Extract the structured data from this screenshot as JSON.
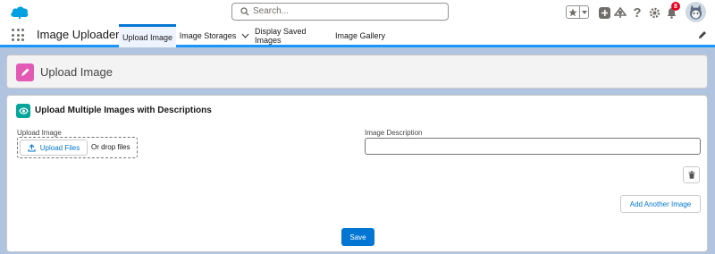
{
  "header": {
    "search_placeholder": "Search...",
    "notification_count": "8",
    "icons": [
      "salesforce-cloud-icon",
      "search-icon",
      "star-icon",
      "chevron-down-icon",
      "add-icon",
      "trailhead-icon",
      "help-icon",
      "gear-icon",
      "bell-icon",
      "avatar"
    ]
  },
  "nav": {
    "app_name": "Image Uploader",
    "tabs": [
      {
        "label": "Upload Image",
        "active": true
      },
      {
        "label": "Image Storages",
        "active": false
      },
      {
        "label": "Display Saved Images",
        "active": false
      },
      {
        "label": "Image Gallery",
        "active": false
      }
    ]
  },
  "page_header": {
    "title": "Upload Image"
  },
  "card": {
    "title": "Upload Multiple Images with Descriptions",
    "upload_label": "Upload Image",
    "upload_button": "Upload Files",
    "drop_text": "Or drop files",
    "description_label": "Image Description",
    "description_value": "",
    "add_button": "Add Another Image",
    "save_button": "Save"
  },
  "colors": {
    "brand": "#0176d3",
    "background": "#b0c4df",
    "page_icon": "#e25ab3",
    "card_icon": "#06a59a",
    "badge": "#ea001e"
  }
}
